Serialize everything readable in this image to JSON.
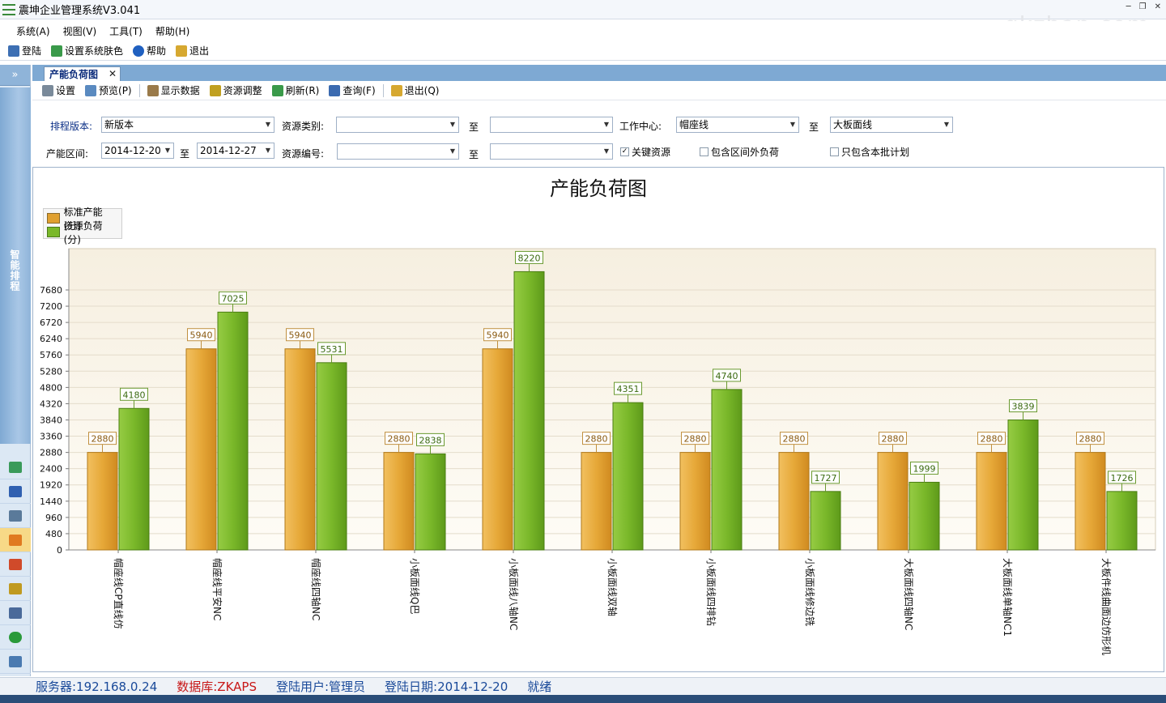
{
  "window": {
    "title": "震坤企业管理系统V3.041",
    "watermark": "gkzhan.com"
  },
  "menu": [
    "系统(A)",
    "视图(V)",
    "工具(T)",
    "帮助(H)"
  ],
  "main_toolbar": [
    {
      "label": "登陆",
      "icon": "login-icon",
      "color": "#3d6fb3"
    },
    {
      "label": "设置系统肤色",
      "icon": "skin-icon",
      "color": "#3a9a4a"
    },
    {
      "label": "帮助",
      "icon": "help-icon",
      "color": "#2060c0"
    },
    {
      "label": "退出",
      "icon": "exit-icon",
      "color": "#d6a830"
    }
  ],
  "left_rail": {
    "toggle": "»",
    "label": "智能排程",
    "icons": [
      "upload-icon",
      "filter-icon",
      "edit-icon",
      "calendar-icon",
      "bar-chart-icon",
      "swap-icon",
      "monitor-icon",
      "power-icon",
      "windows-icon",
      "dual-monitor-icon"
    ]
  },
  "tab": {
    "label": "产能负荷图",
    "close": "✕"
  },
  "form_toolbar": [
    {
      "label": "设置",
      "icon": "printer-icon"
    },
    {
      "label": "预览(P)",
      "icon": "preview-icon"
    },
    {
      "label": "显示数据",
      "icon": "display-data-icon"
    },
    {
      "label": "资源调整",
      "icon": "resource-adjust-icon"
    },
    {
      "label": "刷新(R)",
      "icon": "refresh-icon"
    },
    {
      "label": "查询(F)",
      "icon": "query-icon"
    },
    {
      "label": "退出(Q)",
      "icon": "exit-icon"
    }
  ],
  "filters": {
    "schedule_version_label": "排程版本:",
    "schedule_version_value": "新版本",
    "resource_type_label": "资源类别:",
    "resource_type_from": "",
    "to_label": "至",
    "resource_type_to": "",
    "work_center_label": "工作中心:",
    "work_center_from": "帽座线",
    "work_center_to": "大板面线",
    "capacity_range_label": "产能区间:",
    "date_from": "2014-12-20",
    "date_to": "2014-12-27",
    "resource_code_label": "资源编号:",
    "resource_code_from": "",
    "resource_code_to": "",
    "key_resource_label": "关键资源",
    "key_resource_checked": true,
    "include_outside_label": "包含区间外负荷",
    "include_outside_checked": false,
    "only_batch_label": "只包含本批计划",
    "only_batch_checked": false
  },
  "chart_data": {
    "type": "bar",
    "title": "产能负荷图",
    "categories": [
      "帽座线CP直线仿",
      "帽座线平安NC",
      "帽座线四轴NC",
      "小板面线Q巴",
      "小板面线八轴NC",
      "小板面线双轴",
      "小板面线四排钻",
      "小板面线修边铣",
      "大板面线四轴NC",
      "大板面线单轴NC1",
      "大板件线曲面边仿形机"
    ],
    "series": [
      {
        "name": "标准产能(分)",
        "color": "#e0a030",
        "values": [
          2880,
          5940,
          5940,
          2880,
          5940,
          2880,
          2880,
          2880,
          2880,
          2880,
          2880
        ]
      },
      {
        "name": "资源负荷(分)",
        "color": "#7ab82a",
        "values": [
          4180,
          7025,
          5531,
          2838,
          8220,
          4351,
          4740,
          1727,
          1999,
          3839,
          1726
        ]
      }
    ],
    "yticks": [
      0,
      480,
      960,
      1440,
      1920,
      2400,
      2880,
      3360,
      3840,
      4320,
      4800,
      5280,
      5760,
      6240,
      6720,
      7200,
      7680
    ],
    "ylim": [
      0,
      8900
    ],
    "legend_position": "top-left",
    "grid": true
  },
  "status": {
    "server": "服务器:192.168.0.24",
    "database": "数据库:ZKAPS",
    "user": "登陆用户:管理员",
    "login_date": "登陆日期:2014-12-20",
    "state": "就绪"
  }
}
